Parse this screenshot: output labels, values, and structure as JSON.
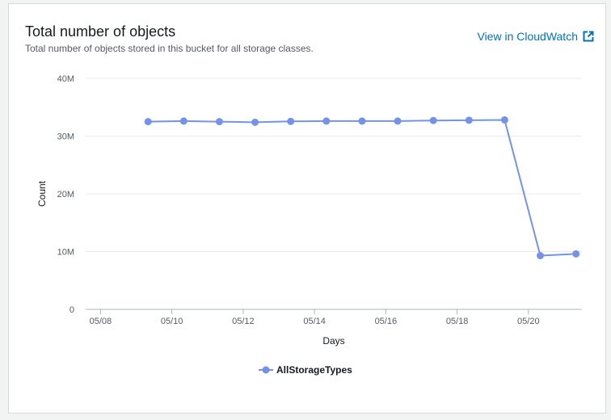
{
  "header": {
    "title": "Total number of objects",
    "subtitle": "Total number of objects stored in this bucket for all storage classes.",
    "link_label": "View in CloudWatch",
    "link_icon": "external-link-icon"
  },
  "colors": {
    "series": "#7492e7",
    "link": "#0073bb",
    "grid": "#e9ebed",
    "axis": "#aab7b8"
  },
  "chart_data": {
    "type": "line",
    "xlabel": "Days",
    "ylabel": "Count",
    "ylim": [
      0,
      40000000
    ],
    "y_ticks": [
      0,
      10000000,
      20000000,
      30000000,
      40000000
    ],
    "y_tick_labels": [
      "0",
      "10M",
      "20M",
      "30M",
      "40M"
    ],
    "xlim": [
      "05/07 14:00",
      "05/21 12:00"
    ],
    "x_ticks": [
      "05/08",
      "05/10",
      "05/12",
      "05/14",
      "05/16",
      "05/18",
      "05/20"
    ],
    "grid": true,
    "legend": "bottom",
    "series": [
      {
        "name": "AllStorageTypes",
        "x": [
          "05/09 08:00",
          "05/10 08:00",
          "05/11 08:00",
          "05/12 08:00",
          "05/13 08:00",
          "05/14 08:00",
          "05/15 08:00",
          "05/16 08:00",
          "05/17 08:00",
          "05/18 08:00",
          "05/19 08:00",
          "05/20 08:00",
          "05/21 08:00"
        ],
        "values": [
          32500000,
          32600000,
          32500000,
          32400000,
          32550000,
          32600000,
          32600000,
          32600000,
          32700000,
          32750000,
          32800000,
          9300000,
          9600000
        ]
      }
    ]
  }
}
